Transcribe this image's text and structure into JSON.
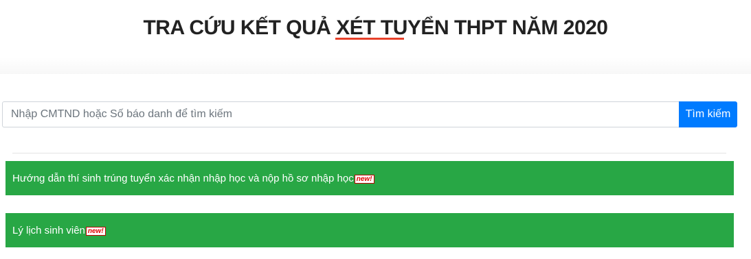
{
  "header": {
    "title": "TRA CỨU KẾT QUẢ XÉT TUYỂN THPT NĂM 2020"
  },
  "search": {
    "placeholder": "Nhập CMTND hoặc Số báo danh để tìm kiếm",
    "value": "",
    "button_label": "Tìm kiếm"
  },
  "notices": [
    {
      "text": "Hướng dẫn thí sinh trúng tuyển xác nhận nhập học và nộp hồ sơ nhập học",
      "badge": "new!",
      "badge_icon": "new-badge-icon"
    },
    {
      "text": "Lý lịch sinh viên",
      "badge": "new!",
      "badge_icon": "new-badge-icon"
    }
  ],
  "colors": {
    "accent_underline": "#e8402a",
    "primary_button": "#007bff",
    "notice_background": "#28a745",
    "badge_text": "#e00000"
  }
}
